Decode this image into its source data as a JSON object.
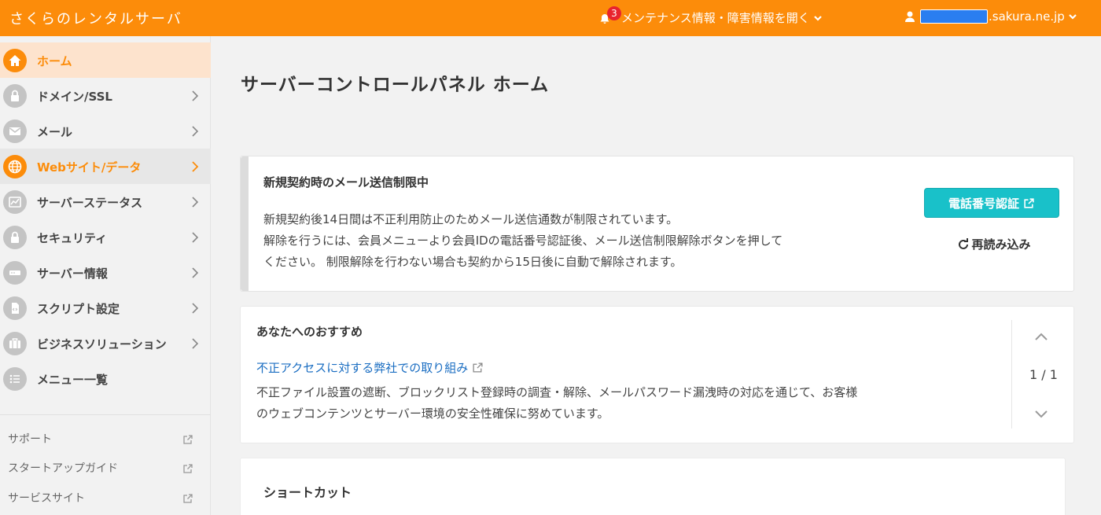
{
  "header": {
    "brand": "さくらのレンタルサーバ",
    "notification_count": "3",
    "maintenance_label": "メンテナンス情報・障害情報を開く",
    "user_domain_suffix": ".sakura.ne.jp",
    "accent_color": "#fc8c0a"
  },
  "sidebar": {
    "items": [
      {
        "label": "ホーム",
        "icon": "home-icon"
      },
      {
        "label": "ドメイン/SSL",
        "icon": "lock-key-icon"
      },
      {
        "label": "メール",
        "icon": "mail-icon"
      },
      {
        "label": "Webサイト/データ",
        "icon": "globe-icon"
      },
      {
        "label": "サーバーステータス",
        "icon": "chart-icon"
      },
      {
        "label": "セキュリティ",
        "icon": "padlock-icon"
      },
      {
        "label": "サーバー情報",
        "icon": "server-icon"
      },
      {
        "label": "スクリプト設定",
        "icon": "script-icon"
      },
      {
        "label": "ビジネスソリューション",
        "icon": "briefcase-icon"
      },
      {
        "label": "メニュー一覧",
        "icon": "list-icon"
      }
    ],
    "links": [
      {
        "label": "サポート"
      },
      {
        "label": "スタートアップガイド"
      },
      {
        "label": "サービスサイト"
      }
    ]
  },
  "main": {
    "page_title": "サーバーコントロールパネル ホーム",
    "alert": {
      "title": "新規契約時のメール送信制限中",
      "body_line1": "新規契約後14日間は不正利用防止のためメール送信通数が制限されています。",
      "body_line2": "解除を行うには、会員メニューより会員IDの電話番号認証後、メール送信制限解除ボタンを押して",
      "body_line3": "ください。 制限解除を行わない場合も契約から15日後に自動で解除されます。",
      "tel_button": "電話番号認証",
      "reload_label": "再読み込み",
      "button_color": "#19c1c9"
    },
    "recommend": {
      "title": "あなたへのおすすめ",
      "link_text": "不正アクセスに対する弊社での取り組み",
      "body_line1": "不正ファイル設置の遮断、ブロックリスト登録時の調査・解除、メールパスワード漏洩時の対応を通じて、お客様",
      "body_line2": "のウェブコンテンツとサーバー環境の安全性確保に努めています。",
      "pager": "1 / 1"
    },
    "shortcut": {
      "title": "ショートカット"
    }
  }
}
